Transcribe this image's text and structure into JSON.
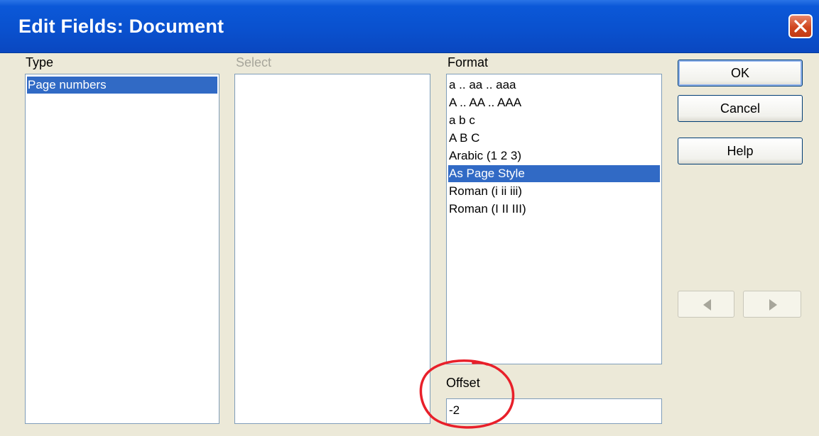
{
  "dialog": {
    "title": "Edit Fields: Document"
  },
  "type_column": {
    "label": "Type",
    "items": [
      "Page numbers"
    ],
    "selected_index": 0
  },
  "select_column": {
    "label": "Select",
    "items": []
  },
  "format_column": {
    "label": "Format",
    "items": [
      "a .. aa .. aaa",
      "A .. AA .. AAA",
      "a b c",
      "A B C",
      "Arabic (1 2 3)",
      "As Page Style",
      "Roman (i ii iii)",
      "Roman (I II III)"
    ],
    "selected_index": 5
  },
  "offset": {
    "label": "Offset",
    "value": "-2"
  },
  "buttons": {
    "ok": "OK",
    "cancel": "Cancel",
    "help": "Help"
  },
  "colors": {
    "titlebar": "#0a50cd",
    "selection": "#316ac5",
    "annotation": "#e8202a"
  }
}
